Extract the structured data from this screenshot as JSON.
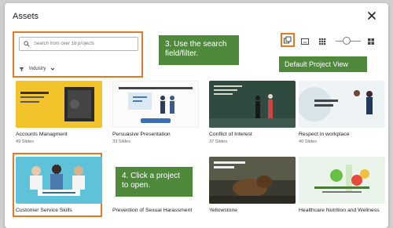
{
  "dialog": {
    "title": "Assets"
  },
  "search": {
    "placeholder": "Search from over 18 projects"
  },
  "filter": {
    "label": "Industry"
  },
  "callouts": {
    "search": "3. Use the search field/filter.",
    "default_view": "Default Project View",
    "click": "4. Click a project to open."
  },
  "toolbar": {
    "icons": [
      "project-view-icon",
      "single-slide-icon",
      "grid-icon",
      "large-grid-icon"
    ],
    "slider_level": 0.35
  },
  "projects": [
    {
      "name": "Accounts Managment",
      "slides": "49 Slides"
    },
    {
      "name": "Persuasive Presentation",
      "slides": "33 Slides"
    },
    {
      "name": "Conflict of Interest",
      "slides": "37 Slides"
    },
    {
      "name": "Respect in workplace",
      "slides": "40 Slides"
    },
    {
      "name": "Customer Service Skills",
      "slides": ""
    },
    {
      "name": "Prevention of Sexual Harassment",
      "slides": ""
    },
    {
      "name": "Yellowstone",
      "slides": ""
    },
    {
      "name": "Healthcare Nutrition and Wellness",
      "slides": ""
    }
  ],
  "colors": {
    "highlight": "#e87722",
    "callout": "#4f8a3c"
  }
}
